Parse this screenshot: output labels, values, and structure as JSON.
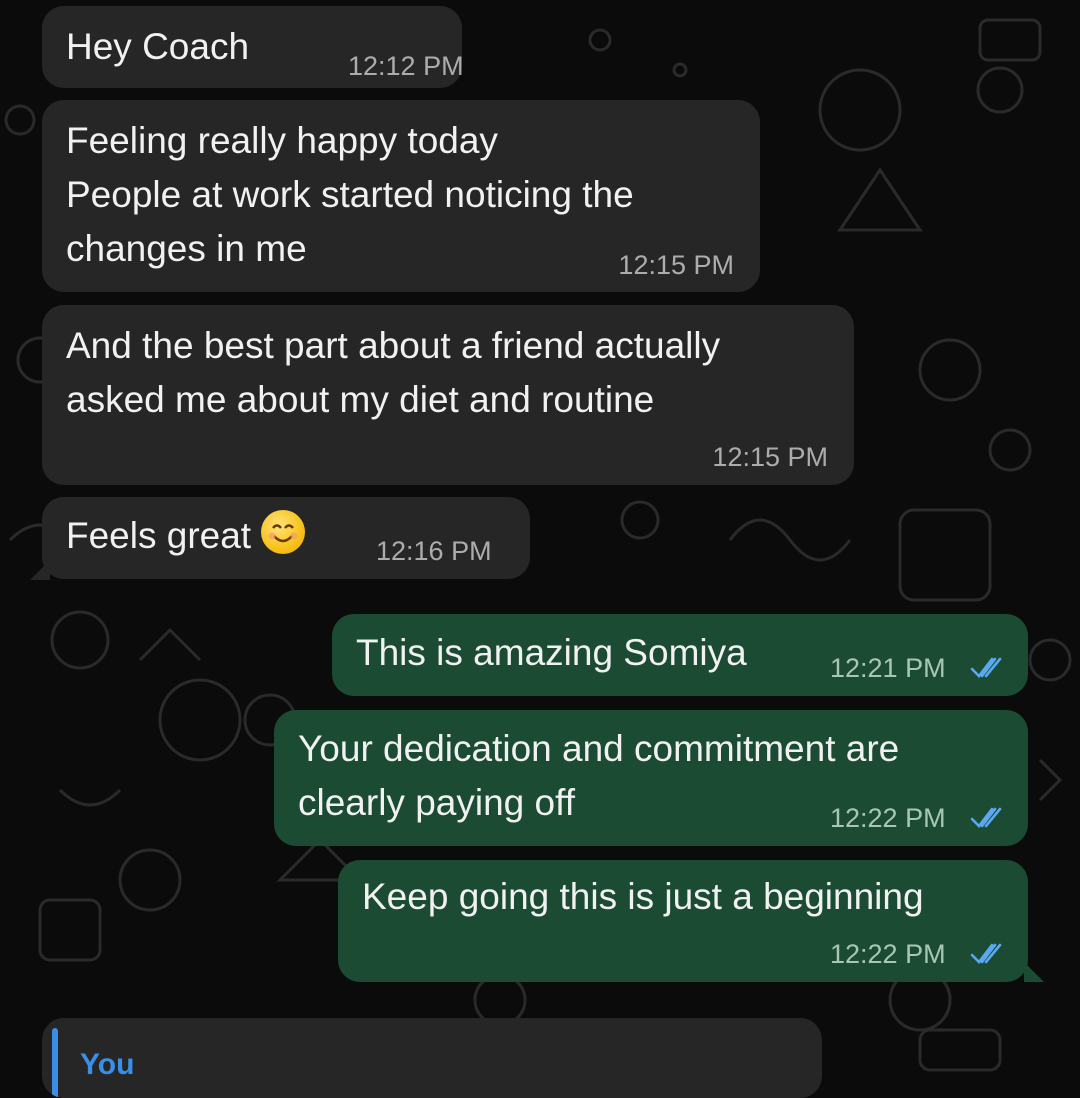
{
  "colors": {
    "background": "#0b0b0b",
    "incoming_bubble": "#262626",
    "outgoing_bubble": "#1b4b33",
    "read_ticks": "#5aa8f0",
    "reply_accent": "#3a8ee6"
  },
  "messages": [
    {
      "direction": "incoming",
      "lines": [
        "Hey Coach"
      ],
      "time": "12:12 PM"
    },
    {
      "direction": "incoming",
      "lines": [
        "Feeling really happy today",
        "People at work started noticing the",
        "changes in me"
      ],
      "time": "12:15 PM"
    },
    {
      "direction": "incoming",
      "lines": [
        "And the best part about a friend actually",
        "asked me about my diet and routine"
      ],
      "time": "12:15 PM"
    },
    {
      "direction": "incoming",
      "lines": [
        "Feels great"
      ],
      "emoji": "smiling-face-icon",
      "time": "12:16 PM"
    },
    {
      "direction": "outgoing",
      "lines": [
        "This is amazing Somiya"
      ],
      "time": "12:21 PM",
      "status": "read"
    },
    {
      "direction": "outgoing",
      "lines": [
        "Your dedication and commitment are",
        "clearly paying off"
      ],
      "time": "12:22 PM",
      "status": "read"
    },
    {
      "direction": "outgoing",
      "lines": [
        "Keep going this is just a beginning"
      ],
      "time": "12:22 PM",
      "status": "read"
    }
  ],
  "reply_preview": {
    "author": "You"
  }
}
